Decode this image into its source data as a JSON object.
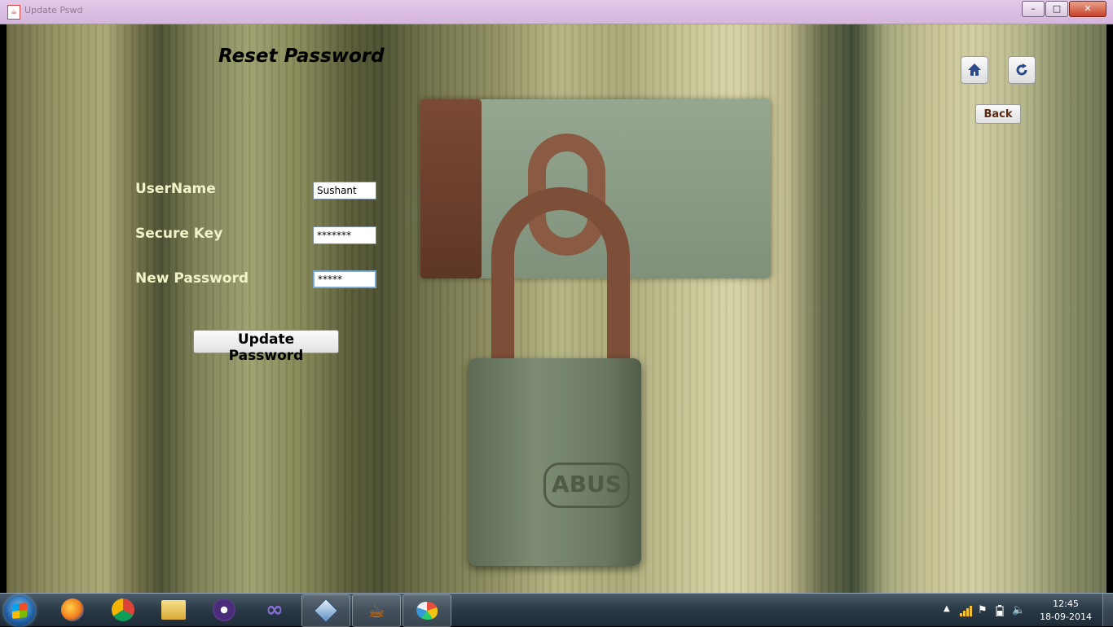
{
  "window": {
    "title": "Update Pswd"
  },
  "form": {
    "title": "Reset Password",
    "fields": [
      {
        "label": "UserName",
        "value": "Sushant"
      },
      {
        "label": "Secure Key",
        "value": "*******"
      },
      {
        "label": "New Password",
        "value": "*****"
      }
    ],
    "update_button": "Update Password",
    "back_button": "Back"
  },
  "lock": {
    "brand": "ABUS"
  },
  "icons": [
    "home-icon",
    "refresh-icon"
  ],
  "taskbar": {
    "apps": [
      "firefox",
      "chrome",
      "windows-explorer",
      "eclipse",
      "visual-studio",
      "virtualbox",
      "java",
      "paint"
    ],
    "clock_time": "12:45",
    "clock_date": "18-09-2014"
  },
  "colors": {
    "label": "#f3f3c8",
    "title_bar": "#d5b6dd",
    "taskbar": "#2a3946"
  }
}
